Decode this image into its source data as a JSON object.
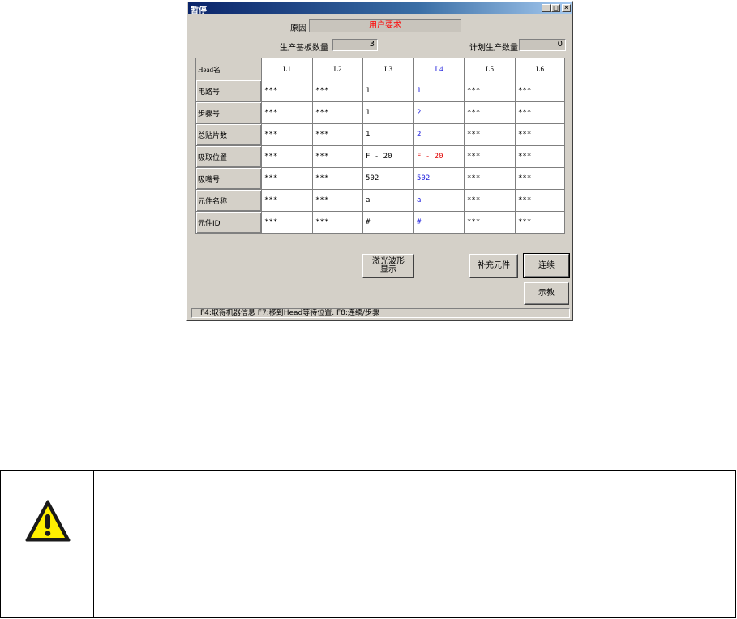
{
  "window": {
    "title": "暂停",
    "controls": {
      "minimize": "_",
      "maximize": "□",
      "close": "×"
    }
  },
  "reason": {
    "label": "原因",
    "value": "用户要求"
  },
  "produced": {
    "label": "生产基板数量",
    "value": "3"
  },
  "planned": {
    "label": "计划生产数量",
    "value": "0"
  },
  "table": {
    "corner": "Head名",
    "columns": [
      "L1",
      "L2",
      "L3",
      "L4",
      "L5",
      "L6"
    ],
    "rows": [
      {
        "label": "电路号",
        "cells": [
          "***",
          "***",
          "1",
          "1",
          "***",
          "***"
        ]
      },
      {
        "label": "步骤号",
        "cells": [
          "***",
          "***",
          "1",
          "2",
          "***",
          "***"
        ]
      },
      {
        "label": "总贴片数",
        "cells": [
          "***",
          "***",
          "1",
          "2",
          "***",
          "***"
        ]
      },
      {
        "label": "吸取位置",
        "cells": [
          "***",
          "***",
          "F - 20",
          "F - 20",
          "***",
          "***"
        ]
      },
      {
        "label": "吸嘴号",
        "cells": [
          "***",
          "***",
          "502",
          "502",
          "***",
          "***"
        ]
      },
      {
        "label": "元件名称",
        "cells": [
          "***",
          "***",
          "a",
          "a",
          "***",
          "***"
        ]
      },
      {
        "label": "元件ID",
        "cells": [
          "***",
          "***",
          "#",
          "#",
          "***",
          "***"
        ]
      }
    ]
  },
  "buttons": {
    "laser_line1": "激光波形",
    "laser_line2": "显示",
    "replenish": "补充元件",
    "continue": "连续",
    "teach": "示教"
  },
  "status_bar": "F4:取得机器信息   F7:移到Head等待位置.   F8:连续/步骤",
  "colors": {
    "highlight_blue": "#1a1adc",
    "error_red": "#e00000",
    "title_bar": "#0a246a"
  },
  "warning_icon": "warning-triangle-icon"
}
